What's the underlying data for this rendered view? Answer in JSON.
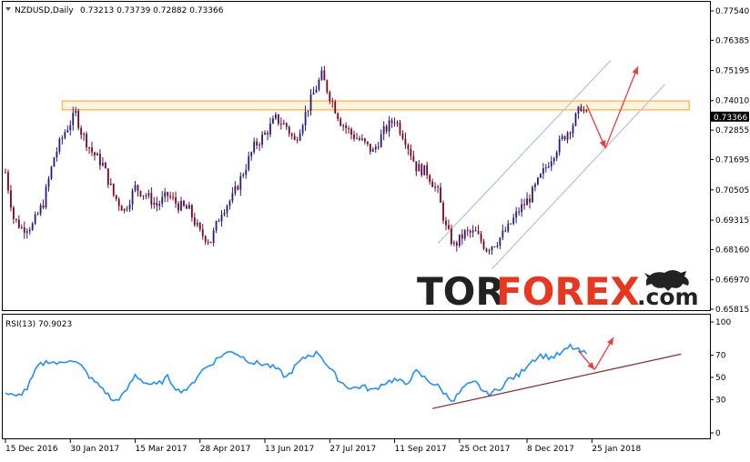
{
  "chart_data": [
    {
      "type": "candlestick",
      "symbol_header": "NZDUSD,Daily",
      "ohlc_header": "0.73213 0.73739 0.72882 0.73366",
      "last_price_label": "0.73366",
      "y_ticks": [
        "0.77540",
        "0.76385",
        "0.75195",
        "0.74010",
        "0.72855",
        "0.71695",
        "0.70505",
        "0.69315",
        "0.68160",
        "0.66970",
        "0.65815"
      ],
      "ylim": [
        0.65815,
        0.7754
      ],
      "x_ticks": [
        "15 Dec 2016",
        "30 Jan 2017",
        "15 Mar 2017",
        "28 Apr 2017",
        "13 Jun 2017",
        "27 Jul 2017",
        "11 Sep 2017",
        "25 Oct 2017",
        "8 Dec 2017",
        "25 Jan 2018"
      ],
      "close_anchors": [
        {
          "i": 0,
          "v": 0.712
        },
        {
          "i": 3,
          "v": 0.694
        },
        {
          "i": 6,
          "v": 0.69
        },
        {
          "i": 10,
          "v": 0.691
        },
        {
          "i": 14,
          "v": 0.7
        },
        {
          "i": 18,
          "v": 0.718
        },
        {
          "i": 22,
          "v": 0.728
        },
        {
          "i": 26,
          "v": 0.735
        },
        {
          "i": 28,
          "v": 0.728
        },
        {
          "i": 32,
          "v": 0.72
        },
        {
          "i": 36,
          "v": 0.715
        },
        {
          "i": 40,
          "v": 0.703
        },
        {
          "i": 44,
          "v": 0.697
        },
        {
          "i": 48,
          "v": 0.706
        },
        {
          "i": 52,
          "v": 0.703
        },
        {
          "i": 56,
          "v": 0.699
        },
        {
          "i": 60,
          "v": 0.703
        },
        {
          "i": 64,
          "v": 0.699
        },
        {
          "i": 68,
          "v": 0.697
        },
        {
          "i": 72,
          "v": 0.688
        },
        {
          "i": 76,
          "v": 0.685
        },
        {
          "i": 80,
          "v": 0.697
        },
        {
          "i": 84,
          "v": 0.702
        },
        {
          "i": 88,
          "v": 0.712
        },
        {
          "i": 92,
          "v": 0.722
        },
        {
          "i": 96,
          "v": 0.727
        },
        {
          "i": 100,
          "v": 0.733
        },
        {
          "i": 104,
          "v": 0.73
        },
        {
          "i": 107,
          "v": 0.724
        },
        {
          "i": 111,
          "v": 0.735
        },
        {
          "i": 114,
          "v": 0.743
        },
        {
          "i": 117,
          "v": 0.75
        },
        {
          "i": 120,
          "v": 0.742
        },
        {
          "i": 124,
          "v": 0.732
        },
        {
          "i": 128,
          "v": 0.727
        },
        {
          "i": 132,
          "v": 0.724
        },
        {
          "i": 136,
          "v": 0.72
        },
        {
          "i": 140,
          "v": 0.728
        },
        {
          "i": 144,
          "v": 0.733
        },
        {
          "i": 148,
          "v": 0.725
        },
        {
          "i": 152,
          "v": 0.714
        },
        {
          "i": 156,
          "v": 0.712
        },
        {
          "i": 160,
          "v": 0.704
        },
        {
          "i": 163,
          "v": 0.69
        },
        {
          "i": 166,
          "v": 0.683
        },
        {
          "i": 170,
          "v": 0.688
        },
        {
          "i": 174,
          "v": 0.688
        },
        {
          "i": 178,
          "v": 0.682
        },
        {
          "i": 182,
          "v": 0.685
        },
        {
          "i": 186,
          "v": 0.69
        },
        {
          "i": 190,
          "v": 0.697
        },
        {
          "i": 194,
          "v": 0.702
        },
        {
          "i": 198,
          "v": 0.71
        },
        {
          "i": 202,
          "v": 0.718
        },
        {
          "i": 206,
          "v": 0.725
        },
        {
          "i": 210,
          "v": 0.731
        },
        {
          "i": 213,
          "v": 0.738
        },
        {
          "i": 215,
          "v": 0.734
        }
      ],
      "support_resistance_zone": [
        0.7365,
        0.74
      ],
      "channel_lines": [
        {
          "from": {
            "i": 160,
            "v": 0.684
          },
          "to": {
            "i": 224,
            "v": 0.756
          }
        },
        {
          "from": {
            "i": 180,
            "v": 0.674
          },
          "to": {
            "i": 244,
            "v": 0.7465
          }
        }
      ],
      "arrows": [
        {
          "from": {
            "i": 215,
            "v": 0.7385
          },
          "to": {
            "i": 222,
            "v": 0.7215
          }
        },
        {
          "from": {
            "i": 222,
            "v": 0.7215
          },
          "to": {
            "i": 234,
            "v": 0.7535
          }
        }
      ],
      "annotation": {
        "text_tor": "TOR",
        "text_forex": "FOREX",
        "text_com": ".com"
      },
      "colors": {
        "up_candle": "#1f1f80",
        "down_candle": "#800020",
        "zone_fill": "#fff3dd",
        "zone_stroke": "#f5b042",
        "channel": "#b7c6da",
        "arrow": "#ef3b3b",
        "logo_grey": "#222222",
        "logo_red": "#e8361f"
      }
    },
    {
      "type": "line",
      "indicator_header": "RSI(13) 70.9023",
      "y_ticks": [
        "100",
        "70",
        "50",
        "30",
        "0"
      ],
      "ylim": [
        0,
        100
      ],
      "series": [
        {
          "values_anchors": [
            {
              "i": 0,
              "v": 36
            },
            {
              "i": 4,
              "v": 32
            },
            {
              "i": 8,
              "v": 40
            },
            {
              "i": 12,
              "v": 60
            },
            {
              "i": 16,
              "v": 65
            },
            {
              "i": 20,
              "v": 62
            },
            {
              "i": 24,
              "v": 67
            },
            {
              "i": 28,
              "v": 60
            },
            {
              "i": 32,
              "v": 48
            },
            {
              "i": 36,
              "v": 40
            },
            {
              "i": 40,
              "v": 28
            },
            {
              "i": 44,
              "v": 35
            },
            {
              "i": 48,
              "v": 52
            },
            {
              "i": 52,
              "v": 45
            },
            {
              "i": 56,
              "v": 43
            },
            {
              "i": 60,
              "v": 50
            },
            {
              "i": 64,
              "v": 38
            },
            {
              "i": 68,
              "v": 40
            },
            {
              "i": 72,
              "v": 55
            },
            {
              "i": 76,
              "v": 62
            },
            {
              "i": 80,
              "v": 70
            },
            {
              "i": 84,
              "v": 74
            },
            {
              "i": 88,
              "v": 68
            },
            {
              "i": 92,
              "v": 63
            },
            {
              "i": 96,
              "v": 62
            },
            {
              "i": 100,
              "v": 58
            },
            {
              "i": 104,
              "v": 50
            },
            {
              "i": 108,
              "v": 62
            },
            {
              "i": 112,
              "v": 70
            },
            {
              "i": 116,
              "v": 72
            },
            {
              "i": 120,
              "v": 58
            },
            {
              "i": 124,
              "v": 46
            },
            {
              "i": 128,
              "v": 40
            },
            {
              "i": 132,
              "v": 42
            },
            {
              "i": 136,
              "v": 38
            },
            {
              "i": 140,
              "v": 45
            },
            {
              "i": 144,
              "v": 48
            },
            {
              "i": 148,
              "v": 44
            },
            {
              "i": 152,
              "v": 55
            },
            {
              "i": 156,
              "v": 48
            },
            {
              "i": 160,
              "v": 42
            },
            {
              "i": 164,
              "v": 32
            },
            {
              "i": 166,
              "v": 30
            },
            {
              "i": 170,
              "v": 42
            },
            {
              "i": 174,
              "v": 45
            },
            {
              "i": 178,
              "v": 35
            },
            {
              "i": 182,
              "v": 38
            },
            {
              "i": 186,
              "v": 48
            },
            {
              "i": 190,
              "v": 52
            },
            {
              "i": 194,
              "v": 64
            },
            {
              "i": 198,
              "v": 70
            },
            {
              "i": 202,
              "v": 68
            },
            {
              "i": 206,
              "v": 72
            },
            {
              "i": 209,
              "v": 78
            },
            {
              "i": 212,
              "v": 74
            },
            {
              "i": 215,
              "v": 71
            }
          ]
        }
      ],
      "trend_line": {
        "from": {
          "i": 158,
          "v": 22
        },
        "to": {
          "i": 250,
          "v": 71
        }
      },
      "arrows": [
        {
          "from": {
            "i": 212,
            "v": 74
          },
          "to": {
            "i": 218,
            "v": 57
          }
        },
        {
          "from": {
            "i": 218,
            "v": 57
          },
          "to": {
            "i": 225,
            "v": 86
          }
        }
      ],
      "colors": {
        "line": "#1e90ff",
        "trend": "#8b2a2a",
        "arrow": "#ef3b3b"
      }
    }
  ]
}
